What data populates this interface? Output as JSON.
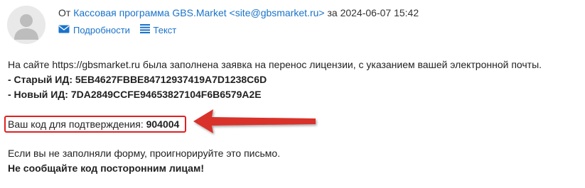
{
  "header": {
    "from_prefix": "От",
    "sender_name": "Кассовая программа GBS.Market",
    "sender_email": "<site@gbsmarket.ru>",
    "date_prefix": "за",
    "date": "2024-06-07 15:42"
  },
  "actions": [
    {
      "label": "Подробности",
      "icon": "envelope-icon"
    },
    {
      "label": "Текст",
      "icon": "lines-icon"
    }
  ],
  "body": {
    "intro": "На сайте https://gbsmarket.ru была заполнена заявка на перенос лицензии, с указанием вашей электронной почты.",
    "old_id": "- Старый ИД: 5EB4627FBBE84712937419A7D1238C6D",
    "new_id": "- Новый ИД: 7DA2849CCFE94653827104F6B6579A2E",
    "code_label": "Ваш код для подтверждения:",
    "code_value": "904004",
    "ignore_note": "Если вы не заполняли форму, проигнорируйте это письмо.",
    "warning": "Не сообщайте код посторонним лицам!"
  },
  "colors": {
    "link": "#1a73c9",
    "highlight": "#e02020"
  }
}
